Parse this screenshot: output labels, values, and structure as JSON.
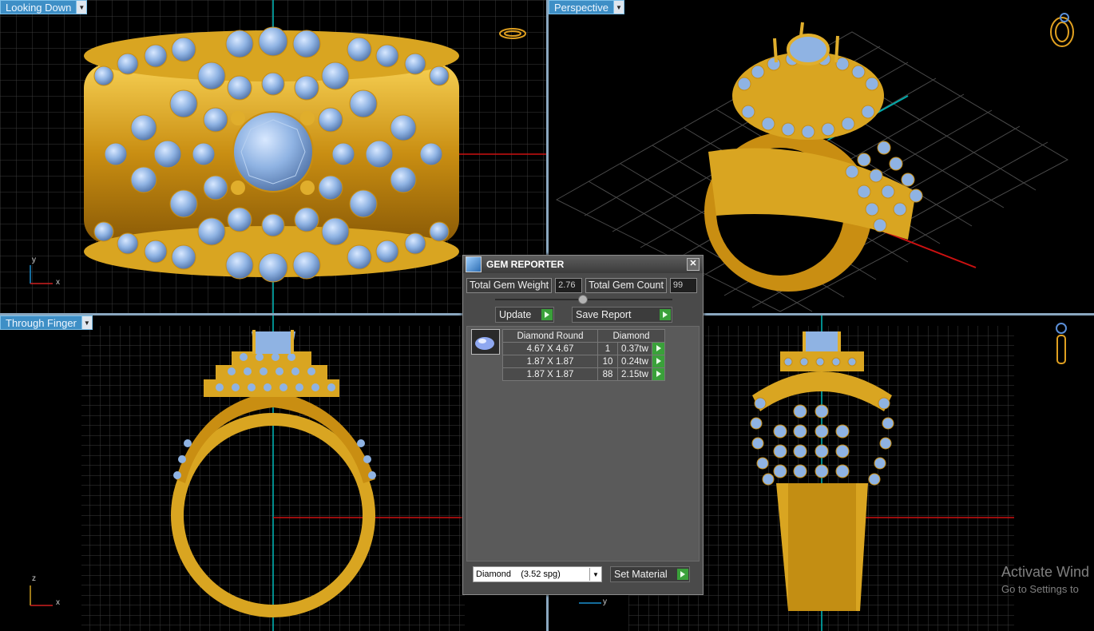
{
  "viewports": {
    "top_left": {
      "label": "Looking Down",
      "axis_v": "y",
      "axis_h": "x"
    },
    "top_right": {
      "label": "Perspective"
    },
    "bottom_left": {
      "label": "Through Finger",
      "axis_v": "z",
      "axis_h": "x"
    },
    "bottom_right": {
      "axis_h": "y"
    }
  },
  "gem_reporter": {
    "title": "GEM REPORTER",
    "close": "✕",
    "total_gem_weight_label": "Total Gem Weight",
    "total_gem_weight": "2.76",
    "total_gem_count_label": "Total Gem Count",
    "total_gem_count": "99",
    "update_label": "Update",
    "save_report_label": "Save Report",
    "headers": [
      "Diamond Round",
      "Diamond"
    ],
    "rows": [
      {
        "size": "4.67 X 4.67",
        "count": "1",
        "weight": "0.37tw"
      },
      {
        "size": "1.87 X 1.87",
        "count": "10",
        "weight": "0.24tw"
      },
      {
        "size": "1.87 X 1.87",
        "count": "88",
        "weight": "2.15tw"
      }
    ],
    "material": "Diamond    (3.52 spg)",
    "set_material_label": "Set Material"
  },
  "watermark": {
    "line1": "Activate Wind",
    "line2": "Go to Settings to"
  },
  "colors": {
    "gold": "#d9a521",
    "gem": "#8fb3e3",
    "accent": "#3e8fc6",
    "button_green": "#3aa13a"
  }
}
